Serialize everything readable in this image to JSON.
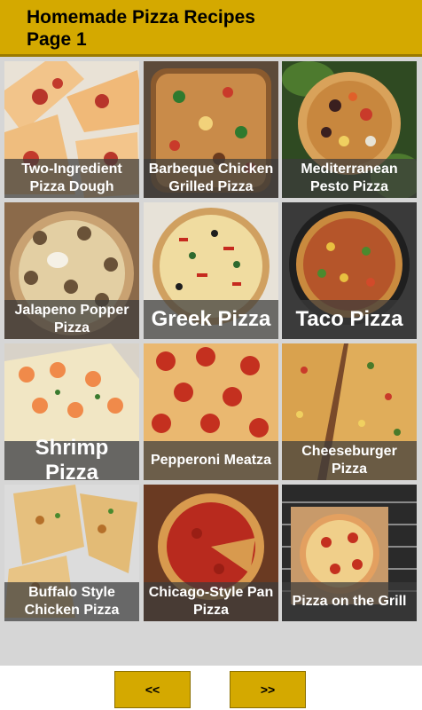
{
  "header": {
    "title": "Homemade Pizza Recipes\nPage 1"
  },
  "recipes": [
    {
      "label": "Two-Ingredient Pizza Dough",
      "size": "normal"
    },
    {
      "label": "Barbeque Chicken Grilled Pizza",
      "size": "normal"
    },
    {
      "label": "Mediterranean Pesto Pizza",
      "size": "normal"
    },
    {
      "label": "Jalapeno Popper Pizza",
      "size": "normal"
    },
    {
      "label": "Greek Pizza",
      "size": "big"
    },
    {
      "label": "Taco Pizza",
      "size": "big"
    },
    {
      "label": "Shrimp Pizza",
      "size": "big"
    },
    {
      "label": "Pepperoni Meatza",
      "size": "normal"
    },
    {
      "label": "Cheeseburger Pizza",
      "size": "normal"
    },
    {
      "label": "Buffalo Style Chicken Pizza",
      "size": "normal"
    },
    {
      "label": "Chicago-Style Pan Pizza",
      "size": "normal"
    },
    {
      "label": "Pizza on the Grill",
      "size": "normal"
    }
  ],
  "nav": {
    "prev_label": "<<",
    "next_label": ">>"
  },
  "colors": {
    "accent": "#d4a900",
    "tile_band": "#3c3c3c",
    "grid_bg": "#d6d6d6"
  }
}
